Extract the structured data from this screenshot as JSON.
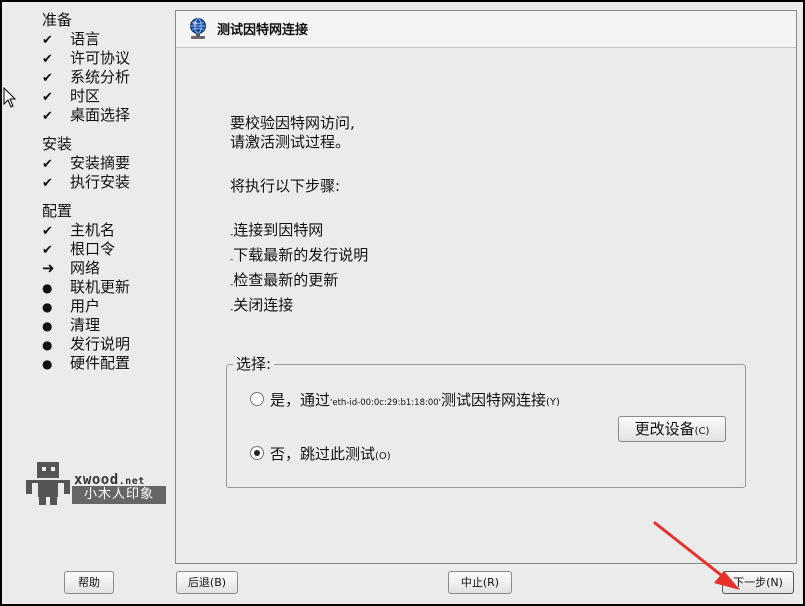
{
  "sidebar": {
    "sections": [
      {
        "title": "准备",
        "items": [
          {
            "label": "语言",
            "status": "done"
          },
          {
            "label": "许可协议",
            "status": "done"
          },
          {
            "label": "系统分析",
            "status": "done"
          },
          {
            "label": "时区",
            "status": "done"
          },
          {
            "label": "桌面选择",
            "status": "done"
          }
        ]
      },
      {
        "title": "安装",
        "items": [
          {
            "label": "安装摘要",
            "status": "done"
          },
          {
            "label": "执行安装",
            "status": "done"
          }
        ]
      },
      {
        "title": "配置",
        "items": [
          {
            "label": "主机名",
            "status": "done"
          },
          {
            "label": "根口令",
            "status": "done"
          },
          {
            "label": "网络",
            "status": "current"
          },
          {
            "label": "联机更新",
            "status": "pending"
          },
          {
            "label": "用户",
            "status": "pending"
          },
          {
            "label": "清理",
            "status": "pending"
          },
          {
            "label": "发行说明",
            "status": "pending"
          },
          {
            "label": "硬件配置",
            "status": "pending"
          }
        ]
      }
    ],
    "marks": {
      "done": "✔",
      "current": "➜",
      "pending": "●"
    }
  },
  "watermark": {
    "brand": "xwood",
    "brand_suffix": ".net",
    "subtitle": "小木人印象"
  },
  "header": {
    "title": "测试因特网连接",
    "icon": "globe-network-icon"
  },
  "content": {
    "intro_line1": "要校验因特网访问,",
    "intro_line2": "请激活测试过程。",
    "steps_intro": "将执行以下步骤:",
    "steps": [
      "连接到因特网",
      "下载最新的发行说明",
      "检查最新的更新",
      "关闭连接"
    ],
    "step_dash": "-",
    "group_label": "选择:",
    "option_yes": {
      "prefix": "是，通过",
      "device": "'eth-id-00:0c:29:b1:18:00'",
      "suffix": "测试因特网连接",
      "mnemonic": "(Y)",
      "checked": false
    },
    "option_no": {
      "label": "否，跳过此测试",
      "mnemonic": "(O)",
      "checked": true
    },
    "change_device": {
      "label": "更改设备",
      "mnemonic": "(C)"
    }
  },
  "buttons": {
    "help": "帮助",
    "back": "后退(B)",
    "abort": "中止(R)",
    "next": "下一步(N)"
  },
  "colors": {
    "annotation_arrow": "#e8302a",
    "window_bg": "#ebebeb"
  }
}
